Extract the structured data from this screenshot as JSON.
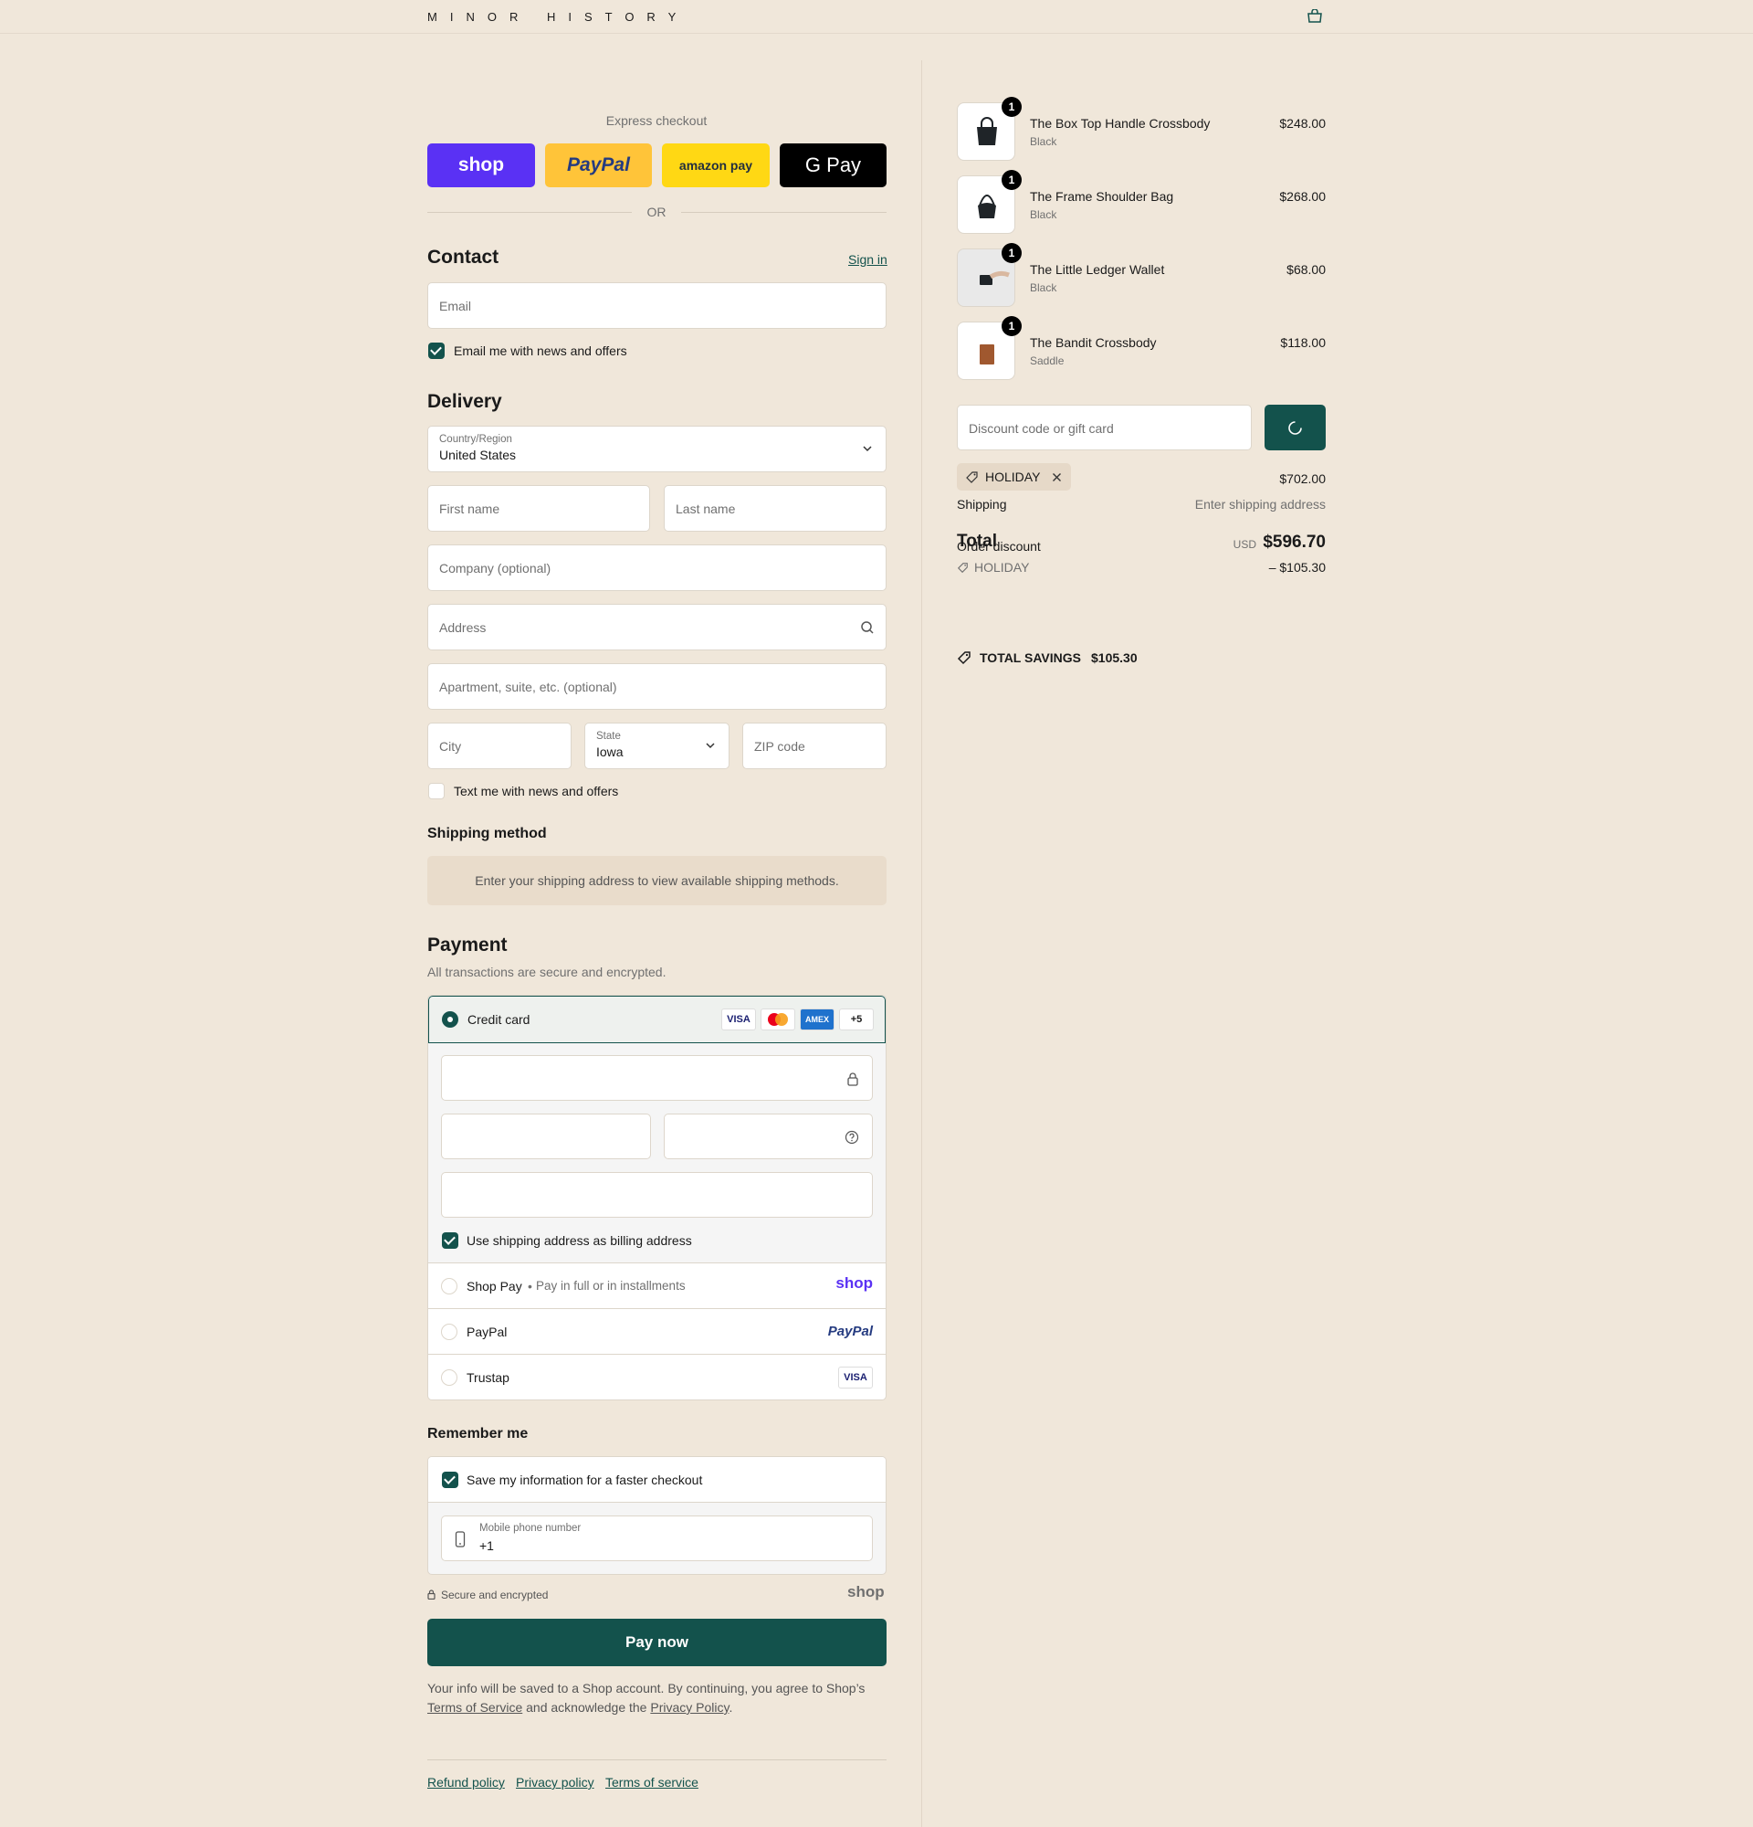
{
  "header": {
    "brand": "MINOR HISTORY"
  },
  "express": {
    "title": "Express checkout",
    "shop_label": "shop",
    "paypal_label": "PayPal",
    "amazon_label": "amazon pay",
    "gpay_label": "G Pay",
    "or_label": "OR"
  },
  "contact": {
    "title": "Contact",
    "sign_in": "Sign in",
    "email_placeholder": "Email",
    "news_label": "Email me with news and offers"
  },
  "delivery": {
    "title": "Delivery",
    "country_label": "Country/Region",
    "country_value": "United States",
    "first_name": "First name",
    "last_name": "Last name",
    "company": "Company (optional)",
    "address": "Address",
    "apartment": "Apartment, suite, etc. (optional)",
    "city": "City",
    "state_label": "State",
    "state_value": "Iowa",
    "zip": "ZIP code",
    "text_news_label": "Text me with news and offers"
  },
  "shipping_method": {
    "title": "Shipping method",
    "notice": "Enter your shipping address to view available shipping methods."
  },
  "payment": {
    "title": "Payment",
    "subtitle": "All transactions are secure and encrypted.",
    "credit_card_label": "Credit card",
    "card_brands": [
      "VISA",
      "MC",
      "AMEX",
      "+5"
    ],
    "billing_label": "Use shipping address as billing address",
    "shop_pay_label": "Shop Pay",
    "shop_pay_sub": "Pay in full or in installments",
    "shop_pay_logo": "shop",
    "paypal_label": "PayPal",
    "paypal_logo": "PayPal",
    "trustap_label": "Trustap",
    "trustap_logo": "VISA"
  },
  "remember": {
    "title": "Remember me",
    "save_label": "Save my information for a faster checkout",
    "phone_label": "Mobile phone number",
    "phone_value": "+1",
    "secure_label": "Secure and encrypted",
    "shop_logo": "shop"
  },
  "pay_button": "Pay now",
  "legal": {
    "line1": "Your info will be saved to a Shop account. By continuing, you agree to Shop’s",
    "terms": "Terms of Service",
    "middle": "and acknowledge the",
    "privacy": "Privacy Policy",
    "end": "."
  },
  "footer": {
    "refund": "Refund policy",
    "privacy": "Privacy policy",
    "terms": "Terms of service"
  },
  "cart": {
    "items": [
      {
        "name": "The Box Top Handle Crossbody",
        "variant": "Black",
        "price": "$248.00",
        "qty": "1"
      },
      {
        "name": "The Frame Shoulder Bag",
        "variant": "Black",
        "price": "$268.00",
        "qty": "1"
      },
      {
        "name": "The Little Ledger Wallet",
        "variant": "Black",
        "price": "$68.00",
        "qty": "1"
      },
      {
        "name": "The Bandit Crossbody",
        "variant": "Saddle",
        "price": "$118.00",
        "qty": "1"
      }
    ],
    "discount_placeholder": "Discount code or gift card",
    "applied_code": "HOLIDAY",
    "subtotal_value": "$702.00",
    "shipping_label": "Shipping",
    "shipping_value": "Enter shipping address",
    "order_discount_label": "Order discount",
    "total_label": "Total",
    "currency": "USD",
    "total_value": "$596.70",
    "discount_code": "HOLIDAY",
    "discount_value": "– $105.30",
    "savings_label": "TOTAL SAVINGS",
    "savings_value": "$105.30"
  },
  "colors": {
    "accent": "#13524c",
    "background": "#f0e7da",
    "shop_purple": "#5a31f4",
    "paypal_yellow": "#ffc439",
    "amazon_yellow": "#ffd814"
  }
}
